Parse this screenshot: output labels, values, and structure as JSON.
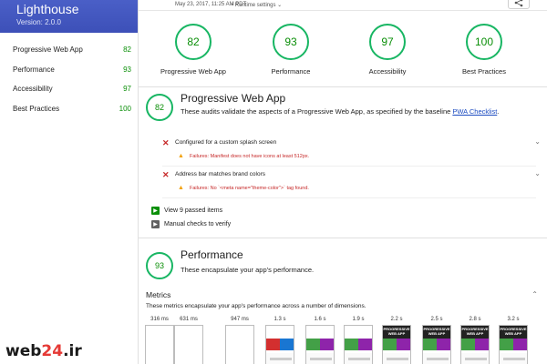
{
  "app": {
    "title": "Lighthouse",
    "version": "Version: 2.0.0"
  },
  "sidebar": {
    "items": [
      {
        "label": "Progressive Web App",
        "score": "82"
      },
      {
        "label": "Performance",
        "score": "93"
      },
      {
        "label": "Accessibility",
        "score": "97"
      },
      {
        "label": "Best Practices",
        "score": "100"
      }
    ]
  },
  "topbar": {
    "date": "May 23, 2017, 11:25 AM PDT",
    "runtime": "• Runtime settings",
    "runtime_chevron": "⌄",
    "share_icon": "share-icon"
  },
  "summary": {
    "gauges": [
      {
        "score": "82",
        "label": "Progressive Web App"
      },
      {
        "score": "93",
        "label": "Performance"
      },
      {
        "score": "97",
        "label": "Accessibility"
      },
      {
        "score": "100",
        "label": "Best Practices"
      }
    ]
  },
  "pwa": {
    "score": "82",
    "title": "Progressive Web App",
    "desc_prefix": "These audits validate the aspects of a Progressive Web App, as specified by the baseline ",
    "desc_link": "PWA Checklist",
    "desc_suffix": ".",
    "audits": [
      {
        "name": "Configured for a custom splash screen",
        "failure": "Failures: Manifest does not have icons at least 512px."
      },
      {
        "name": "Address bar matches brand colors",
        "failure": "Failures: No `<meta name=\"theme-color\">` tag found."
      }
    ],
    "passed": "View 9 passed items",
    "manual": "Manual checks to verify"
  },
  "performance": {
    "score": "93",
    "title": "Performance",
    "desc": "These encapsulate your app's performance.",
    "metrics_title": "Metrics",
    "metrics_desc": "These metrics encapsulate your app's performance across a number of dimensions.",
    "timeline": [
      "316 ms",
      "631 ms",
      "947 ms",
      "1.3 s",
      "1.6 s",
      "1.9 s",
      "2.2 s",
      "2.5 s",
      "2.8 s",
      "3.2 s"
    ],
    "frame_logo": "PROGRESSIVE WEB APP"
  },
  "watermark": {
    "text": "web",
    "num": "24",
    "tld": ".ir"
  },
  "colors": {
    "header": "#3f51b5",
    "pass": "#0a8f08",
    "fail": "#c62828",
    "warn": "#f2a20f"
  }
}
